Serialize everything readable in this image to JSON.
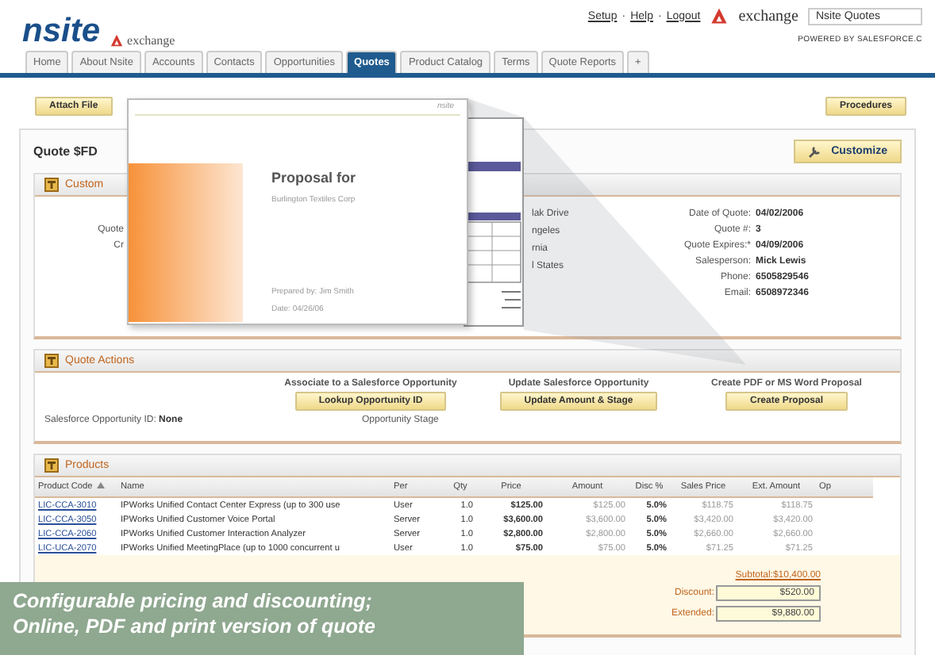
{
  "header": {
    "logo": "nsite",
    "partner_logo": "exchange",
    "links": [
      "Setup",
      "Help",
      "Logout"
    ],
    "link_separator": "·",
    "app_logo": "exchange",
    "app_name": "Nsite Quotes",
    "powered_by": "POWERED BY SALESFORCE.C"
  },
  "tabs": [
    {
      "label": "Home",
      "selected": false
    },
    {
      "label": "About Nsite",
      "selected": false
    },
    {
      "label": "Accounts",
      "selected": false
    },
    {
      "label": "Contacts",
      "selected": false
    },
    {
      "label": "Opportunities",
      "selected": false
    },
    {
      "label": "Quotes",
      "selected": true
    },
    {
      "label": "Product Catalog",
      "selected": false
    },
    {
      "label": "Terms",
      "selected": false
    },
    {
      "label": "Quote Reports",
      "selected": false
    },
    {
      "label": "+",
      "selected": false
    }
  ],
  "toolbar": {
    "attach": "Attach File",
    "procedures": "Procedures"
  },
  "quote": {
    "title": "Quote $FD",
    "customize": "Customize"
  },
  "customer": {
    "heading": "Custom",
    "labels": [
      "Quote",
      "Cr"
    ],
    "address": [
      "lak Drive",
      "ngeles",
      "rnia",
      "l States"
    ],
    "fields": [
      {
        "label": "Date of Quote:",
        "value": "04/02/2006"
      },
      {
        "label": "Quote #:",
        "value": "3"
      },
      {
        "label": "Quote Expires:*",
        "value": "04/09/2006"
      },
      {
        "label": "Salesperson:",
        "value": "Mick Lewis"
      },
      {
        "label": "Phone:",
        "value": "6505829546"
      },
      {
        "label": "Email:",
        "value": "6508972346"
      }
    ]
  },
  "quote_actions": {
    "heading": "Quote Actions",
    "groups": [
      {
        "title": "Associate to a Salesforce Opportunity",
        "button": "Lookup Opportunity ID"
      },
      {
        "title": "Update Salesforce Opportunity",
        "button": "Update Amount & Stage"
      },
      {
        "title": "Create PDF or MS Word Proposal",
        "button": "Create Proposal"
      }
    ],
    "opportunity_id": {
      "label": "Salesforce Opportunity ID:",
      "value": "None"
    },
    "opportunity_stage": "Opportunity Stage"
  },
  "products": {
    "heading": "Products",
    "columns": [
      "Product Code",
      "Name",
      "Per",
      "Qty",
      "Price",
      "Amount",
      "Disc %",
      "Sales Price",
      "Ext. Amount",
      "Op"
    ],
    "rows": [
      [
        "LIC-CCA-3010",
        "IPWorks Unified Contact Center Express (up to 300 use",
        "User",
        "1.0",
        "$125.00",
        "$125.00",
        "5.0%",
        "$118.75",
        "$118.75"
      ],
      [
        "LIC-CCA-3050",
        "IPWorks Unified Customer Voice Portal",
        "Server",
        "1.0",
        "$3,600.00",
        "$3,600.00",
        "5.0%",
        "$3,420.00",
        "$3,420.00"
      ],
      [
        "LIC-CCA-2060",
        "IPWorks Unified Customer Interaction Analyzer",
        "Server",
        "1.0",
        "$2,800.00",
        "$2,800.00",
        "5.0%",
        "$2,660.00",
        "$2,660.00"
      ],
      [
        "LIC-UCA-2070",
        "IPWorks Unified MeetingPlace (up to 1000 concurrent u",
        "User",
        "1.0",
        "$75.00",
        "$75.00",
        "5.0%",
        "$71.25",
        "$71.25"
      ]
    ],
    "subtotal": {
      "label": "Subtotal:",
      "value": "$10,400.00"
    },
    "discount": {
      "label": "Discount:",
      "value": "$520.00"
    },
    "extended": {
      "label": "Extended:",
      "value": "$9,880.00"
    }
  },
  "proposal": {
    "brand": "nsite",
    "title": "Proposal for",
    "company": "Burlington Textiles Corp",
    "prepared_by": "Prepared by: Jim Smith",
    "date": "Date: 04/26/06"
  },
  "caption": [
    "Configurable pricing and discounting;",
    "Online, PDF and print version of quote"
  ]
}
